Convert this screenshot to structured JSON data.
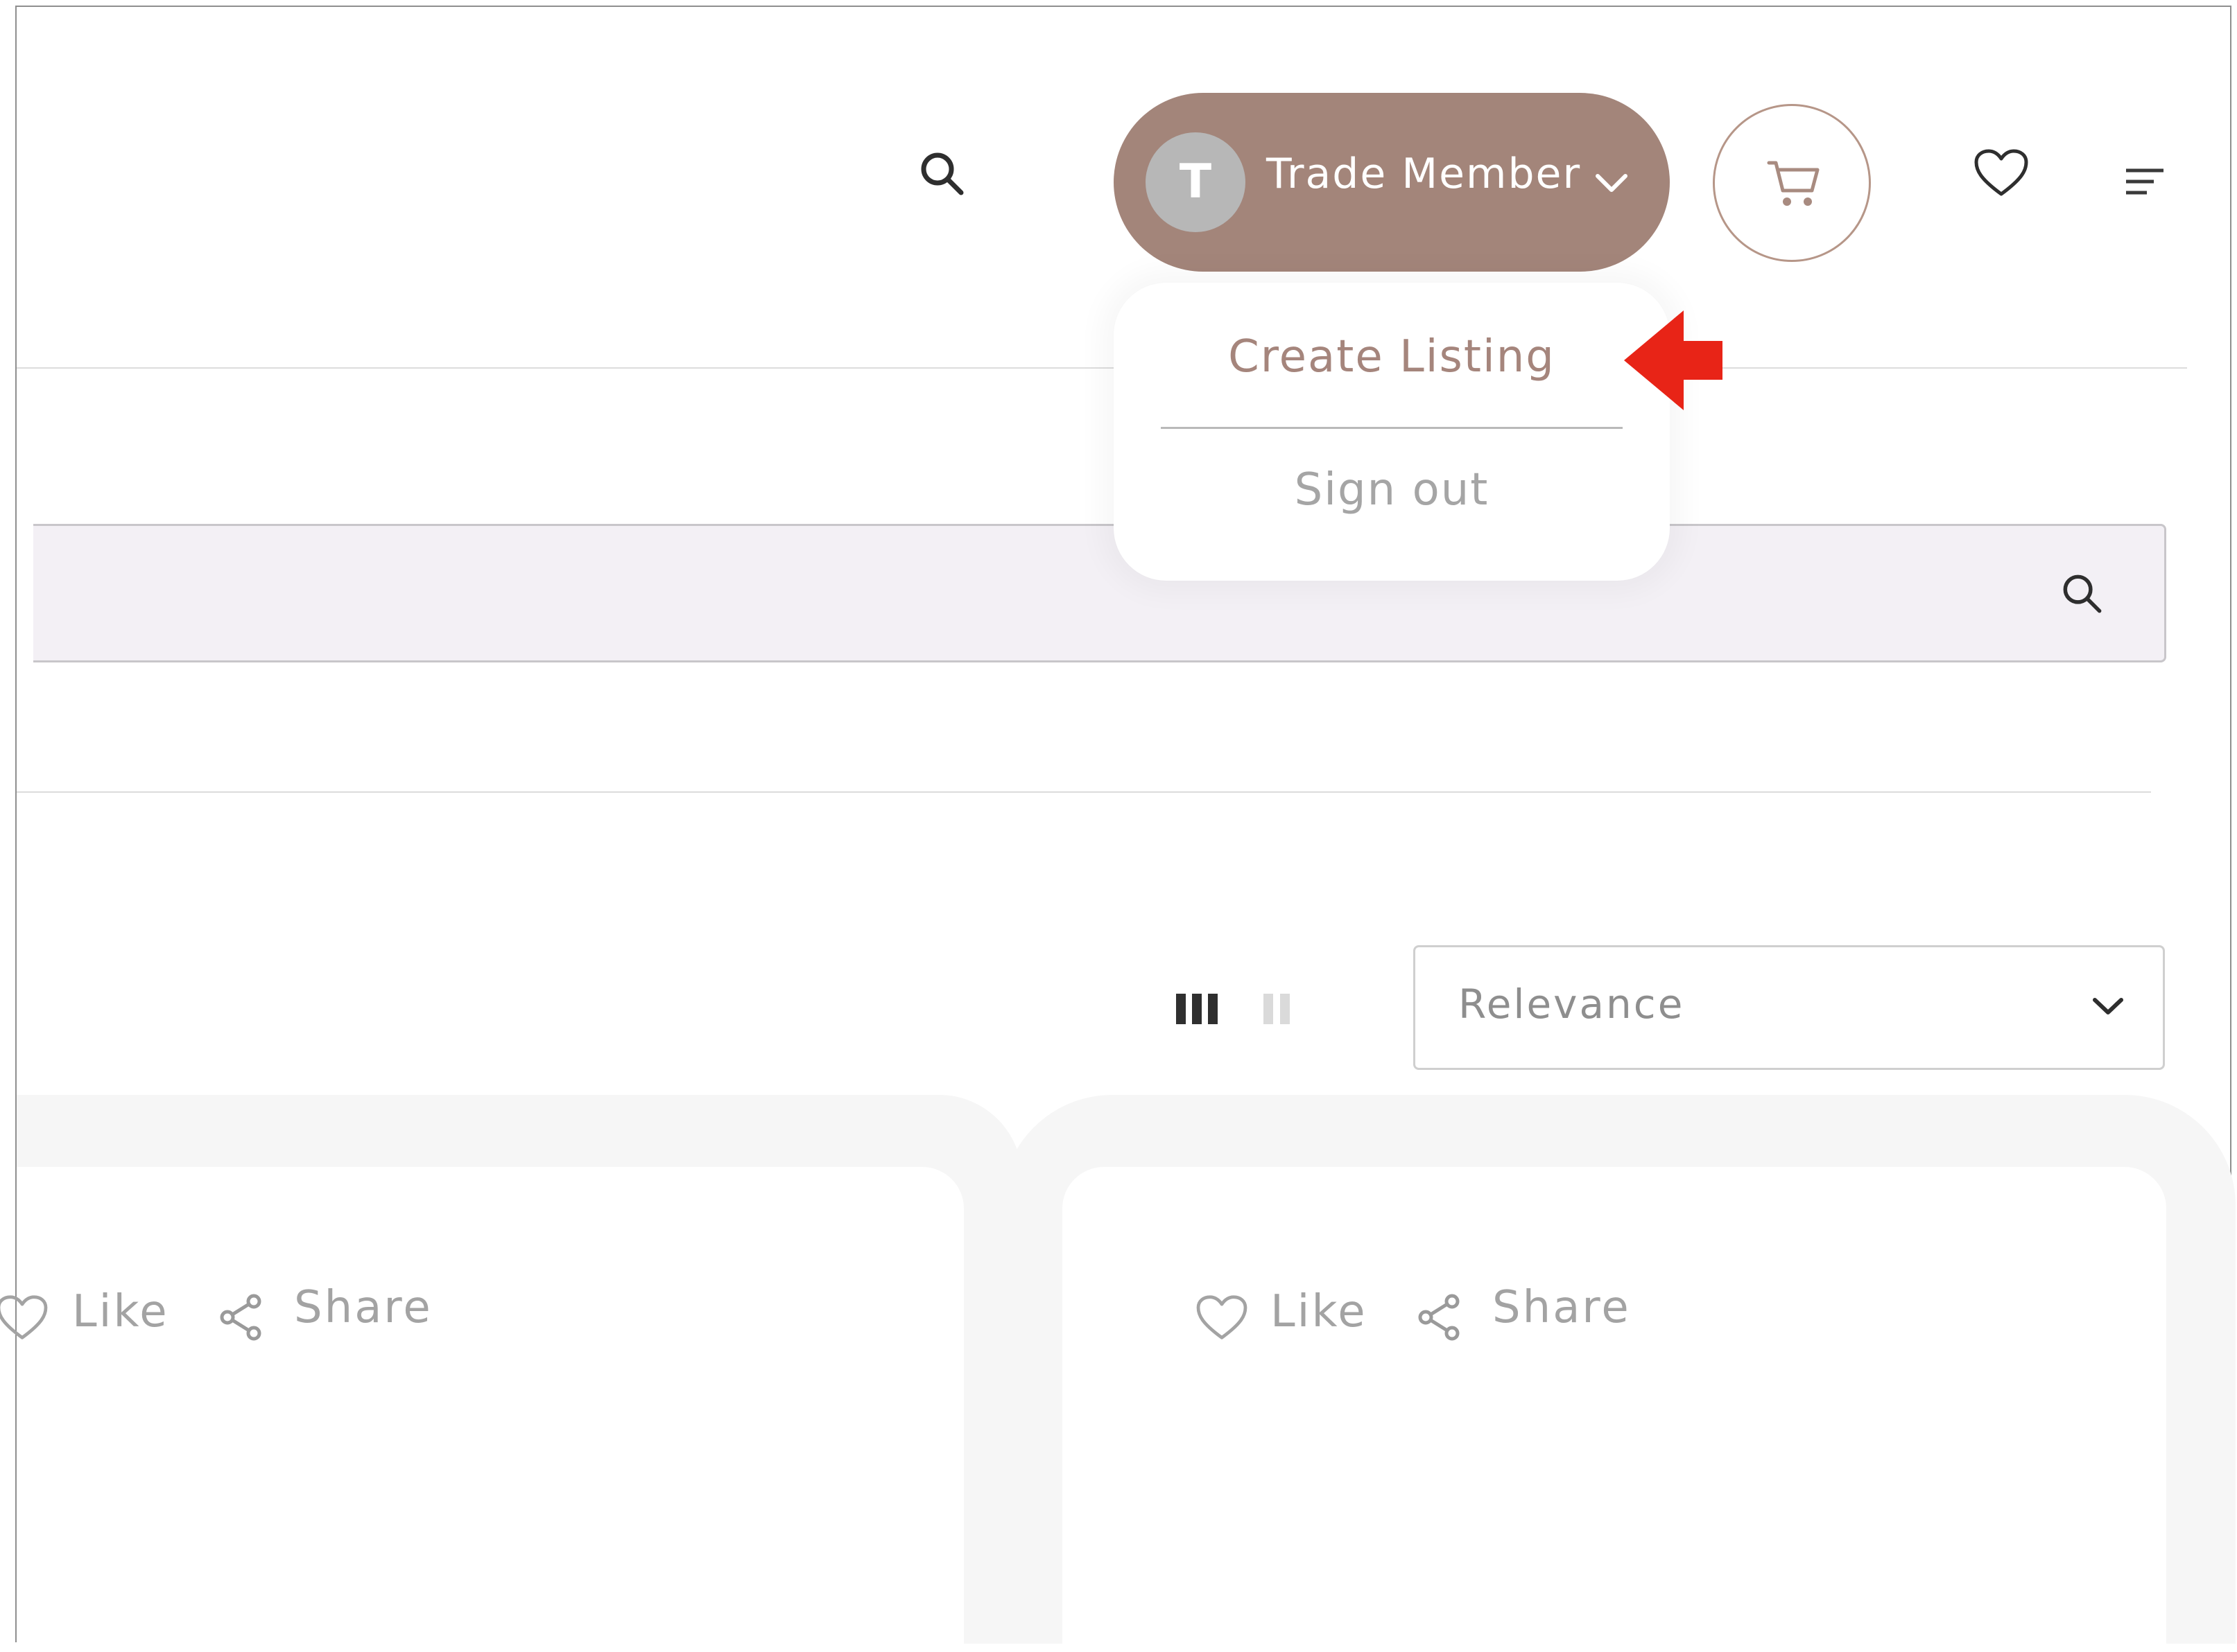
{
  "header": {
    "user": {
      "initial": "T",
      "name": "Trade Member"
    },
    "icons": [
      "search-icon",
      "chevron-down-icon",
      "cart-icon",
      "heart-icon",
      "menu-icon"
    ]
  },
  "user_menu": {
    "items": [
      {
        "label": "Create Listing",
        "color": "#a5857c"
      },
      {
        "label": "Sign out",
        "color": "#a5a5a5"
      }
    ]
  },
  "toolbar": {
    "sort": {
      "selected": "Relevance"
    },
    "view_modes": [
      "three-column-view",
      "two-column-view"
    ]
  },
  "cards": [
    {
      "like_label": "Like",
      "share_label": "Share"
    },
    {
      "like_label": "Like",
      "share_label": "Share"
    }
  ],
  "colors": {
    "accent": "#a3857a",
    "annotation_arrow": "#e82417"
  }
}
